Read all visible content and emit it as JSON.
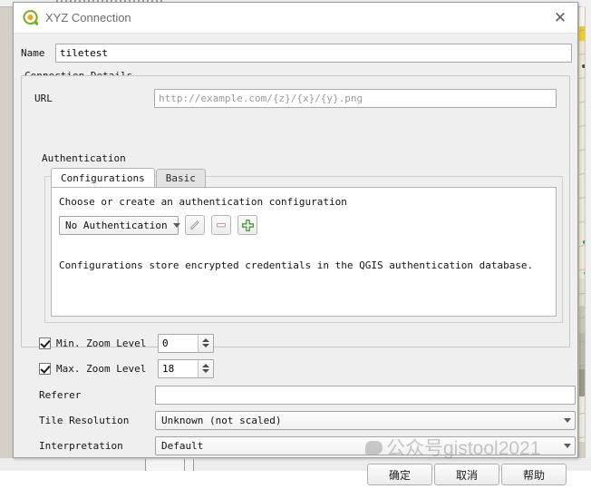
{
  "window": {
    "title": "XYZ Connection",
    "icon": "qgis-logo-icon",
    "close_label": "✕"
  },
  "form": {
    "name_label": "Name",
    "name_value": "tiletest",
    "connection_details_caption": "Connection Details",
    "url_label": "URL",
    "url_value": "",
    "url_placeholder": "http://example.com/{z}/{x}/{y}.png",
    "authentication_caption": "Authentication"
  },
  "auth": {
    "tabs": [
      {
        "label": "Configurations",
        "active": true
      },
      {
        "label": "Basic",
        "active": false
      }
    ],
    "choose_text": "Choose or create an authentication configuration",
    "selected_config": "No Authentication",
    "buttons": [
      {
        "name": "edit-config-button",
        "icon": "pencil-icon",
        "enabled": false
      },
      {
        "name": "remove-config-button",
        "icon": "minus-icon",
        "enabled": false
      },
      {
        "name": "add-config-button",
        "icon": "plus-icon",
        "enabled": true
      }
    ],
    "info_text": "Configurations store encrypted credentials in the QGIS authentication database."
  },
  "zoom_levels": {
    "min": {
      "label": "Min. Zoom Level",
      "checked": true,
      "value": "0"
    },
    "max": {
      "label": "Max. Zoom Level",
      "checked": true,
      "value": "18"
    }
  },
  "fields": {
    "referer_label": "Referer",
    "referer_value": "",
    "tile_resolution_label": "Tile Resolution",
    "tile_resolution_value": "Unknown (not scaled)",
    "interpretation_label": "Interpretation",
    "interpretation_value": "Default"
  },
  "dialog_buttons": {
    "ok": "确定",
    "cancel": "取消",
    "help": "帮助"
  },
  "watermark": {
    "text": "公众号gistool2021"
  },
  "colors": {
    "accent_green": "#4f9a28",
    "logo_orange": "#f0a81e",
    "plus_green": "#4f9340",
    "dialog_bg": "#efefef",
    "titlebar_bg": "#ffffff"
  }
}
